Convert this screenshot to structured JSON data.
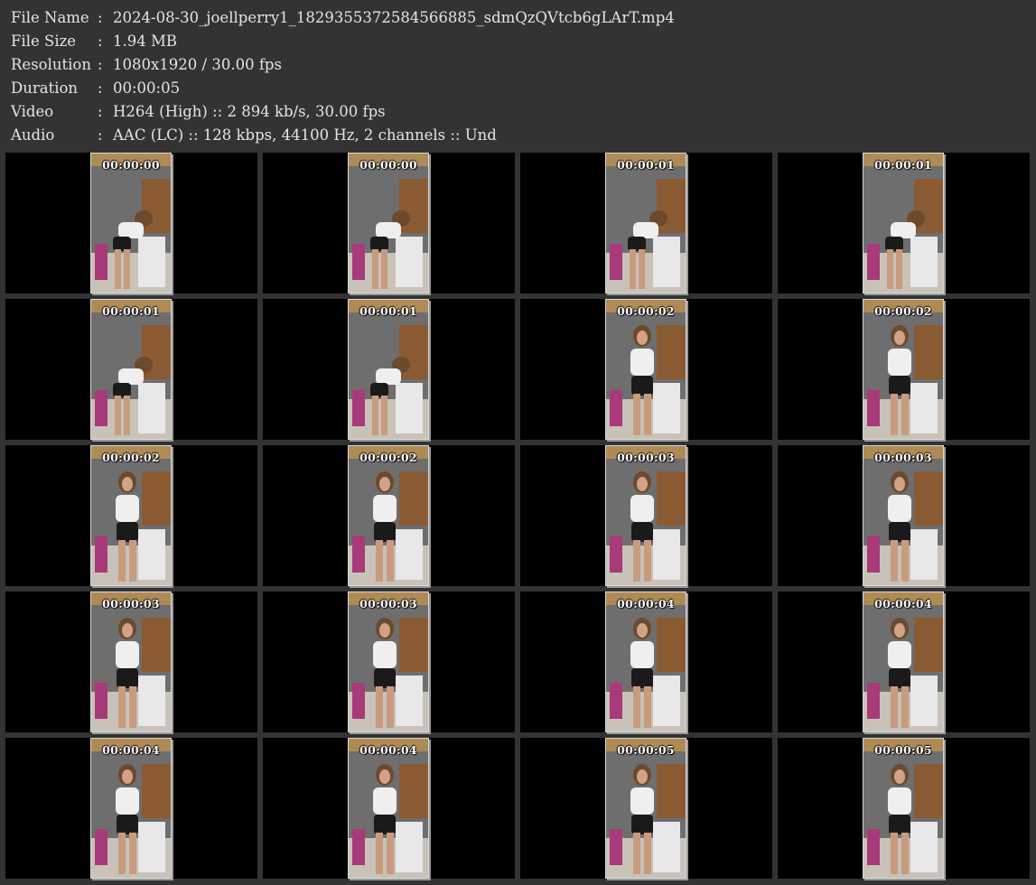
{
  "info": [
    {
      "label": "File Name",
      "sep": ":",
      "value": "2024-08-30_joellperry1_1829355372584566885_sdmQzQVtcb6gLArT.mp4"
    },
    {
      "label": "File Size",
      "sep": ":",
      "value": "1.94 MB"
    },
    {
      "label": "Resolution",
      "sep": ":",
      "value": "1080x1920 / 30.00 fps"
    },
    {
      "label": "Duration",
      "sep": ":",
      "value": "00:00:05"
    },
    {
      "label": "Video",
      "sep": ":",
      "value": "H264 (High) :: 2 894 kb/s, 30.00 fps"
    },
    {
      "label": "Audio",
      "sep": ":",
      "value": "AAC (LC) :: 128 kbps, 44100 Hz, 2 channels :: Und"
    }
  ],
  "thumbnails": [
    {
      "timestamp": "00:00:00"
    },
    {
      "timestamp": "00:00:00"
    },
    {
      "timestamp": "00:00:01"
    },
    {
      "timestamp": "00:00:01"
    },
    {
      "timestamp": "00:00:01"
    },
    {
      "timestamp": "00:00:01"
    },
    {
      "timestamp": "00:00:02"
    },
    {
      "timestamp": "00:00:02"
    },
    {
      "timestamp": "00:00:02"
    },
    {
      "timestamp": "00:00:02"
    },
    {
      "timestamp": "00:00:03"
    },
    {
      "timestamp": "00:00:03"
    },
    {
      "timestamp": "00:00:03"
    },
    {
      "timestamp": "00:00:03"
    },
    {
      "timestamp": "00:00:04"
    },
    {
      "timestamp": "00:00:04"
    },
    {
      "timestamp": "00:00:04"
    },
    {
      "timestamp": "00:00:04"
    },
    {
      "timestamp": "00:00:05"
    },
    {
      "timestamp": "00:00:05"
    }
  ],
  "colors": {
    "background": "#333333",
    "cell": "#000000",
    "text": "#e4e4e4",
    "thumb_border": "#d8d8d8"
  }
}
